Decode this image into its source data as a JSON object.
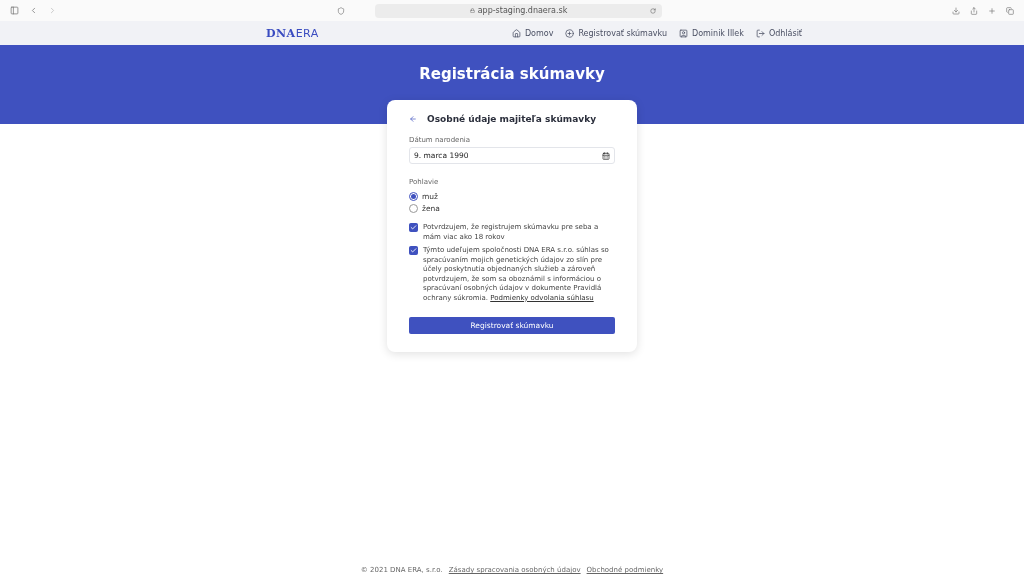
{
  "browser": {
    "url": "app-staging.dnaera.sk"
  },
  "nav": {
    "logo_bold": "DNA",
    "logo_light": "ERA",
    "items": [
      {
        "kind": "home",
        "label": "Domov"
      },
      {
        "kind": "add",
        "label": "Registrovať skúmavku"
      },
      {
        "kind": "user",
        "label": "Dominik Illek"
      },
      {
        "kind": "logout",
        "label": "Odhlásiť"
      }
    ]
  },
  "banner": {
    "title": "Registrácia skúmavky"
  },
  "form": {
    "title": "Osobné údaje majiteľa skúmavky",
    "birth_date": {
      "label": "Dátum narodenia",
      "value": "9. marca 1990"
    },
    "gender": {
      "label": "Pohlavie",
      "options": [
        {
          "label": "muž",
          "selected": true
        },
        {
          "label": "žena",
          "selected": false
        }
      ]
    },
    "consents": [
      {
        "text": "Potvrdzujem, že registrujem skúmavku pre seba a mám viac ako 18 rokov",
        "checked": true
      },
      {
        "text": "Týmto udeľujem spoločnosti DNA ERA s.r.o. súhlas so spracúvaním mojich genetických údajov zo slín pre účely poskytnutia objednaných služieb a zároveň potvrdzujem, že som sa oboznámil s informáciou o spracúvaní osobných údajov v dokumente Pravidlá ochrany súkromia.",
        "link": "Podmienky odvolania súhlasu",
        "checked": true
      }
    ],
    "submit": "Registrovať skúmavku"
  },
  "footer": {
    "copyright": "© 2021 DNA ERA, s.r.o.",
    "links": [
      "Zásady spracovania osobných údajov",
      "Obchodné podmienky"
    ]
  }
}
